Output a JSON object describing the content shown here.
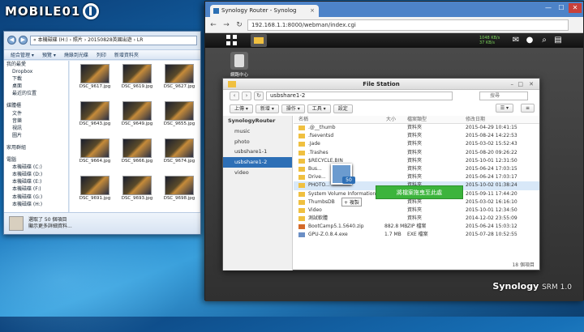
{
  "watermark": "MOBILE01",
  "explorer": {
    "address": "« 本機磁碟 (H:) › 照片 › 20150828英國出遊 › LR",
    "toolbar": [
      "組合管理 ▾",
      "預覽 ▾",
      "燒錄到光碟",
      "列印",
      "新增資料夾"
    ],
    "sidebar": [
      {
        "label": "我的最愛",
        "type": "h"
      },
      {
        "label": "Dropbox",
        "type": "i"
      },
      {
        "label": "下載",
        "type": "i"
      },
      {
        "label": "桌面",
        "type": "i"
      },
      {
        "label": "最近的位置",
        "type": "i"
      },
      {
        "label": "",
        "type": "gap"
      },
      {
        "label": "媒體櫃",
        "type": "h"
      },
      {
        "label": "文件",
        "type": "i"
      },
      {
        "label": "音樂",
        "type": "i"
      },
      {
        "label": "視訊",
        "type": "i"
      },
      {
        "label": "圖片",
        "type": "i"
      },
      {
        "label": "",
        "type": "gap"
      },
      {
        "label": "家用群組",
        "type": "h"
      },
      {
        "label": "",
        "type": "gap"
      },
      {
        "label": "電腦",
        "type": "h"
      },
      {
        "label": "本機磁碟 (C:)",
        "type": "i"
      },
      {
        "label": "本機磁碟 (D:)",
        "type": "i"
      },
      {
        "label": "本機磁碟 (E:)",
        "type": "i"
      },
      {
        "label": "本機磁碟 (F:)",
        "type": "i"
      },
      {
        "label": "本機磁碟 (G:)",
        "type": "i"
      },
      {
        "label": "本機磁碟 (H:)",
        "type": "i"
      }
    ],
    "thumbs": [
      "DSC_9617.jpg",
      "DSC_9619.jpg",
      "DSC_9627.jpg",
      "DSC_9643.jpg",
      "DSC_9649.jpg",
      "DSC_9655.jpg",
      "DSC_9664.jpg",
      "DSC_9666.jpg",
      "DSC_9674.jpg",
      "DSC_9691.jpg",
      "DSC_9693.jpg",
      "DSC_9698.jpg"
    ],
    "status_line1": "選取了 50 個項目",
    "status_line2": "顯示更多詳細資料..."
  },
  "browser": {
    "tab_title": "Synology Router - Synolog",
    "url": "192.168.1.1:8000/webman/index.cgi",
    "minimize": "—",
    "maximize": "☐",
    "close": "✕"
  },
  "dsm": {
    "status": "1048 KB/s\n37 KB/s",
    "desktop_icon_label": "網路中心",
    "brand": "Synology",
    "brand_suffix": "SRM 1.0"
  },
  "filestation": {
    "title": "File Station",
    "path": "usbshare1-2",
    "search_placeholder": "搜尋",
    "toolbar": [
      "上傳 ▾",
      "新增 ▾",
      "操作 ▾",
      "工具 ▾",
      "設定"
    ],
    "tree": [
      {
        "label": "SynologyRouter",
        "type": "root"
      },
      {
        "label": "music",
        "type": "i"
      },
      {
        "label": "photo",
        "type": "i"
      },
      {
        "label": "usbshare1-1",
        "type": "i"
      },
      {
        "label": "usbshare1-2",
        "type": "sel"
      },
      {
        "label": "video",
        "type": "i"
      }
    ],
    "columns": {
      "name": "名稱",
      "size": "大小",
      "type": "檔案類型",
      "modified": "修改日期"
    },
    "files": [
      {
        "name": ".@__thumb",
        "size": "",
        "type": "資料夾",
        "modified": "2015-04-29 10:41:15",
        "icon": "folder"
      },
      {
        "name": ".fseventsd",
        "size": "",
        "type": "資料夾",
        "modified": "2015-08-24 14:22:53",
        "icon": "folder"
      },
      {
        "name": ".Jade",
        "size": "",
        "type": "資料夾",
        "modified": "2015-03-02 15:52:43",
        "icon": "folder"
      },
      {
        "name": ".Trashes",
        "size": "",
        "type": "資料夾",
        "modified": "2015-08-20 09:26:22",
        "icon": "folder"
      },
      {
        "name": "$RECYCLE.BIN",
        "size": "",
        "type": "資料夾",
        "modified": "2015-10-01 12:31:50",
        "icon": "folder"
      },
      {
        "name": "Bus...",
        "size": "",
        "type": "資料夾",
        "modified": "2015-06-24 17:03:15",
        "icon": "folder"
      },
      {
        "name": "Drive...",
        "size": "",
        "type": "資料夾",
        "modified": "2015-06-24 17:03:17",
        "icon": "folder"
      },
      {
        "name": "PHOTO...",
        "size": "",
        "type": "資料夾",
        "modified": "2015-10-02 01:38:24",
        "icon": "folder",
        "sel": true
      },
      {
        "name": "System Volume Information",
        "size": "",
        "type": "資料夾",
        "modified": "2015-09-11 17:44:20",
        "icon": "folder"
      },
      {
        "name": "ThumbsDB",
        "size": "",
        "type": "資料夾",
        "modified": "2015-03-02 16:16:10",
        "icon": "folder"
      },
      {
        "name": "Video",
        "size": "",
        "type": "資料夾",
        "modified": "2015-10-01 12:34:50",
        "icon": "folder"
      },
      {
        "name": "測試軟體",
        "size": "",
        "type": "資料夾",
        "modified": "2014-12-02 23:55:09",
        "icon": "folder"
      },
      {
        "name": "BootCamp5.1.5640.zip",
        "size": "882.8 MB",
        "type": "ZIP 檔案",
        "modified": "2015-06-24 15:03:12",
        "icon": "zip"
      },
      {
        "name": "GPU-Z.0.8.4.exe",
        "size": "1.7 MB",
        "type": "EXE 檔案",
        "modified": "2015-07-28 10:52:55",
        "icon": "exe"
      }
    ],
    "item_count": "18 個項目",
    "upload_hint": "將檔案拖曳至此處",
    "drag_count": "50",
    "drag_copy": "+ 複製"
  }
}
